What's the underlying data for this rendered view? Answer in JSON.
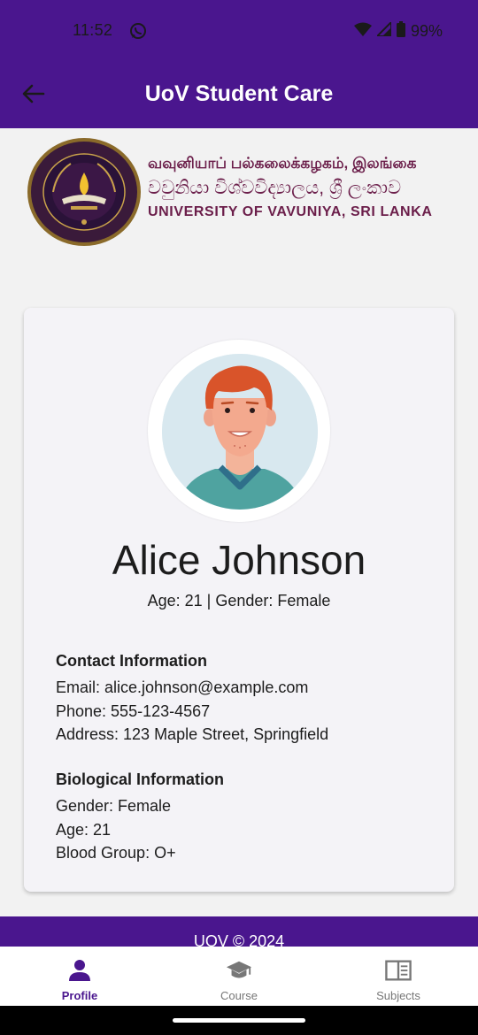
{
  "status_bar": {
    "time": "11:52",
    "battery": "99%",
    "icons": [
      "whatsapp-icon",
      "wifi-icon",
      "signal-icon",
      "battery-icon"
    ]
  },
  "app_bar": {
    "title": "UoV Student Care",
    "back_icon": "arrow-left-icon"
  },
  "university": {
    "name_tamil": "வவுனியாப் பல்கலைக்கழகம், இலங்கை",
    "name_sinhala": "වවුනියා විශ්වවිද්‍යාලය, ශ්‍රී ලංකාව",
    "name_english": "UNIVERSITY OF VAVUNIYA, SRI LANKA"
  },
  "profile": {
    "name": "Alice Johnson",
    "summary": "Age: 21 | Gender: Female",
    "contact": {
      "heading": "Contact Information",
      "email": "Email: alice.johnson@example.com",
      "phone": "Phone: 555-123-4567",
      "address": "Address: 123 Maple Street, Springfield"
    },
    "biological": {
      "heading": "Biological Information",
      "gender": "Gender: Female",
      "age": "Age: 21",
      "blood_group": "Blood Group: O+"
    }
  },
  "footer": {
    "text": "UOV © 2024"
  },
  "bottom_nav": {
    "items": [
      {
        "label": "Profile",
        "icon": "person-icon",
        "active": true
      },
      {
        "label": "Course",
        "icon": "graduation-cap-icon",
        "active": false
      },
      {
        "label": "Subjects",
        "icon": "book-icon",
        "active": false
      }
    ]
  },
  "colors": {
    "primary": "#4a168e",
    "accent_text": "#6b1e4a",
    "background": "#f2f2f2"
  }
}
